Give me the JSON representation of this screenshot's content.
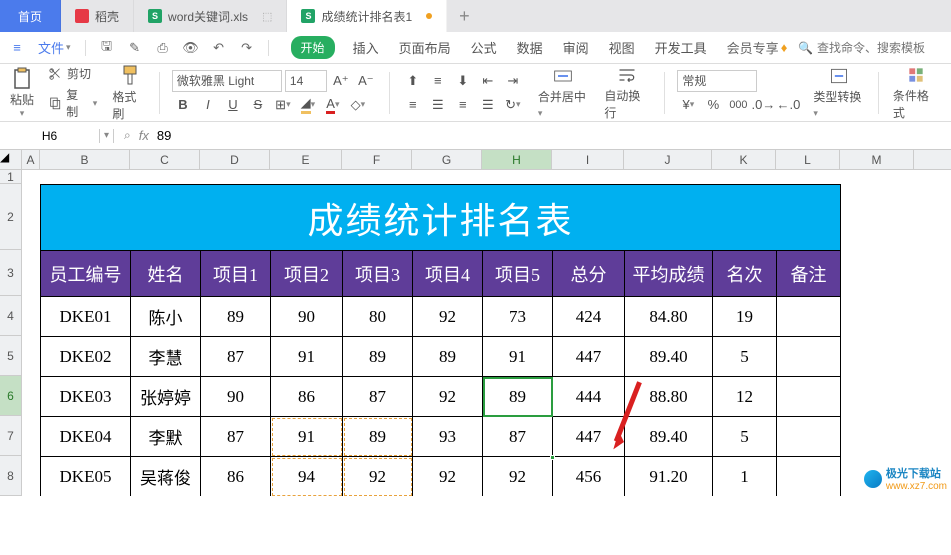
{
  "tabs": {
    "home": "首页",
    "t1": "稻壳",
    "t2": "word关键词.xls",
    "t3": "成绩统计排名表1",
    "plus": "+"
  },
  "menu": {
    "file": "文件",
    "ribbon": [
      "开始",
      "插入",
      "页面布局",
      "公式",
      "数据",
      "审阅",
      "视图",
      "开发工具",
      "会员专享"
    ],
    "search_ph": "查找命令、搜索模板"
  },
  "toolbar": {
    "cut": "剪切",
    "copy": "复制",
    "paste": "粘贴",
    "format_painter": "格式刷",
    "font_name": "微软雅黑 Light",
    "font_size": "14",
    "merge_center": "合并居中",
    "wrap": "自动换行",
    "num_format": "常规",
    "type_convert": "类型转换",
    "cond_fmt": "条件格式"
  },
  "formula_bar": {
    "name_box": "H6",
    "fx": "fx",
    "value": "89"
  },
  "columns": [
    "A",
    "B",
    "C",
    "D",
    "E",
    "F",
    "G",
    "H",
    "I",
    "J",
    "K",
    "L",
    "M"
  ],
  "rows": [
    "1",
    "2",
    "3",
    "4",
    "5",
    "6",
    "7",
    "8"
  ],
  "selected": {
    "col": "H",
    "row": "6"
  },
  "table": {
    "title": "成绩统计排名表",
    "headers": [
      "员工编号",
      "姓名",
      "项目1",
      "项目2",
      "项目3",
      "项目4",
      "项目5",
      "总分",
      "平均成绩",
      "名次",
      "备注"
    ],
    "data": [
      [
        "DKE01",
        "陈小",
        "89",
        "90",
        "80",
        "92",
        "73",
        "424",
        "84.80",
        "19",
        ""
      ],
      [
        "DKE02",
        "李慧",
        "87",
        "91",
        "89",
        "89",
        "91",
        "447",
        "89.40",
        "5",
        ""
      ],
      [
        "DKE03",
        "张婷婷",
        "90",
        "86",
        "87",
        "92",
        "89",
        "444",
        "88.80",
        "12",
        ""
      ],
      [
        "DKE04",
        "李默",
        "87",
        "91",
        "89",
        "93",
        "87",
        "447",
        "89.40",
        "5",
        ""
      ],
      [
        "DKE05",
        "吴蒋俊",
        "86",
        "94",
        "92",
        "92",
        "92",
        "456",
        "91.20",
        "1",
        ""
      ]
    ]
  },
  "watermark": {
    "line1": "极光下载站",
    "line2": "www.xz7.com"
  }
}
